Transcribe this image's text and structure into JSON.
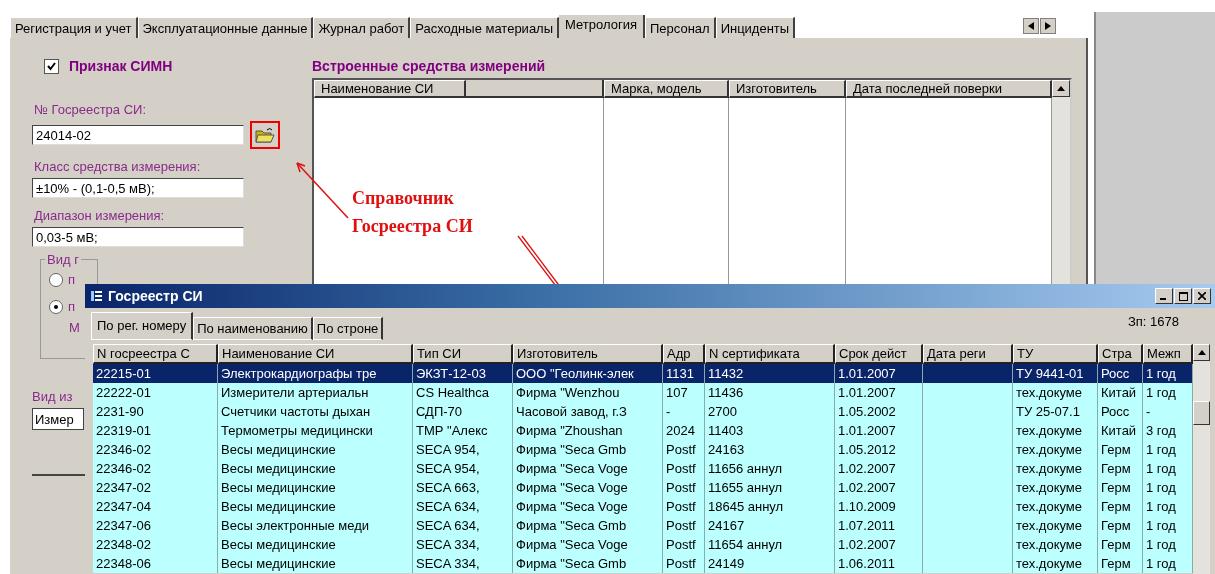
{
  "main_tabs": [
    {
      "label": "Регистрация и учет",
      "selected": false
    },
    {
      "label": "Эксплуатационные данные",
      "selected": false
    },
    {
      "label": "Журнал работ",
      "selected": false
    },
    {
      "label": "Расходные материалы",
      "selected": false
    },
    {
      "label": "Метрология",
      "selected": true
    },
    {
      "label": "Персонал",
      "selected": false
    },
    {
      "label": "Инциденты",
      "selected": false
    }
  ],
  "simn": {
    "label": "Признак СИМН",
    "checked": true
  },
  "fields": [
    {
      "label": "№ Госреестра СИ:",
      "value": "24014-02",
      "kind": "lookup"
    },
    {
      "label": "Класс средства измерения:",
      "value": "±10% - (0,1-0,5 мВ);",
      "kind": "text"
    },
    {
      "label": "Диапазон измерения:",
      "value": "0,03-5 мВ;",
      "kind": "text"
    }
  ],
  "group_box": {
    "label": "Вид г",
    "radios": [
      {
        "label": "п",
        "selected": false
      },
      {
        "label": "п",
        "selected": true
      }
    ],
    "note": "М"
  },
  "type_field": {
    "label": "Вид из",
    "value": "Измер"
  },
  "embedded": {
    "title": "Встроенные средства измерений",
    "columns": [
      "Наименование СИ",
      "Марка, модель",
      "Изготовитель",
      "Дата последней поверки"
    ]
  },
  "annotation": {
    "text": "Справочник Госреестра СИ"
  },
  "popup": {
    "title": "Госреестр СИ",
    "tabs": [
      {
        "label": "По рег. номеру",
        "selected": true
      },
      {
        "label": "По наименованию",
        "selected": false
      },
      {
        "label": "По строне",
        "selected": false
      }
    ],
    "record_count": "Зп: 1678",
    "columns": [
      "N госреестра С",
      "Наименование СИ",
      "Тип СИ",
      "Изготовитель",
      "Адр",
      "N сертификата",
      "Срок дейст",
      "Дата реги",
      "ТУ",
      "Стра",
      "Межп"
    ],
    "rows": [
      {
        "selected": true,
        "cells": [
          "22215-01",
          "Электрокардиографы тре",
          "ЭКЗТ-12-03",
          "ООО \"Геолинк-элек",
          "1131",
          "11432",
          "1.01.2007",
          null,
          "ТУ 9441-01",
          "Росс",
          "1 год"
        ]
      },
      {
        "selected": false,
        "cells": [
          "22222-01",
          "Измерители артериальн",
          "CS Healthca",
          "Фирма \"Wenzhou",
          "107",
          "11436",
          "1.01.2007",
          null,
          "тех.докуме",
          "Китай",
          "1 год"
        ]
      },
      {
        "selected": false,
        "cells": [
          "2231-90",
          "Счетчики частоты дыхан",
          "СДП-70",
          "Часовой завод, г.З",
          "-",
          "2700",
          "1.05.2002",
          null,
          "ТУ 25-07.1",
          "Росс",
          "-"
        ]
      },
      {
        "selected": false,
        "cells": [
          "22319-01",
          "Термометры медицински",
          "ТМР \"Алекс",
          "Фирма \"Zhoushan",
          "2024",
          "11403",
          "1.01.2007",
          null,
          "тех.докуме",
          "Китай",
          "3 год"
        ]
      },
      {
        "selected": false,
        "cells": [
          "22346-02",
          "Весы медицинские",
          "SECA 954,",
          "Фирма \"Seca Gmb",
          "Postf",
          "24163",
          "1.05.2012",
          null,
          "тех.докуме",
          "Герм",
          "1 год"
        ]
      },
      {
        "selected": false,
        "cells": [
          "22346-02",
          "Весы медицинские",
          "SECA 954,",
          "Фирма \"Seca Voge",
          "Postf",
          "11656 аннул",
          "1.02.2007",
          null,
          "тех.докуме",
          "Герм",
          "1 год"
        ]
      },
      {
        "selected": false,
        "cells": [
          "22347-02",
          "Весы медицинские",
          "SECA 663,",
          "Фирма \"Seca Voge",
          "Postf",
          "11655 аннул",
          "1.02.2007",
          null,
          "тех.докуме",
          "Герм",
          "1 год"
        ]
      },
      {
        "selected": false,
        "cells": [
          "22347-04",
          "Весы медицинские",
          "SECA 634,",
          "Фирма \"Seca Voge",
          "Postf",
          "18645 аннул",
          "1.10.2009",
          null,
          "тех.докуме",
          "Герм",
          "1 год"
        ]
      },
      {
        "selected": false,
        "cells": [
          "22347-06",
          "Весы электронные меди",
          "SECA 634,",
          "Фирма \"Seca Gmb",
          "Postf",
          "24167",
          "1.07.2011",
          null,
          "тех.докуме",
          "Герм",
          "1 год"
        ]
      },
      {
        "selected": false,
        "cells": [
          "22348-02",
          "Весы медицинские",
          "SECA 334,",
          "Фирма \"Seca Voge",
          "Postf",
          "11654 аннул",
          "1.02.2007",
          null,
          "тех.докуме",
          "Герм",
          "1 год"
        ]
      },
      {
        "selected": false,
        "cells": [
          "22348-06",
          "Весы медицинские",
          "SECA 334,",
          "Фирма \"Seca Gmb",
          "Postf",
          "24149",
          "1.06.2011",
          null,
          "тех.докуме",
          "Герм",
          "1 год"
        ]
      }
    ]
  }
}
